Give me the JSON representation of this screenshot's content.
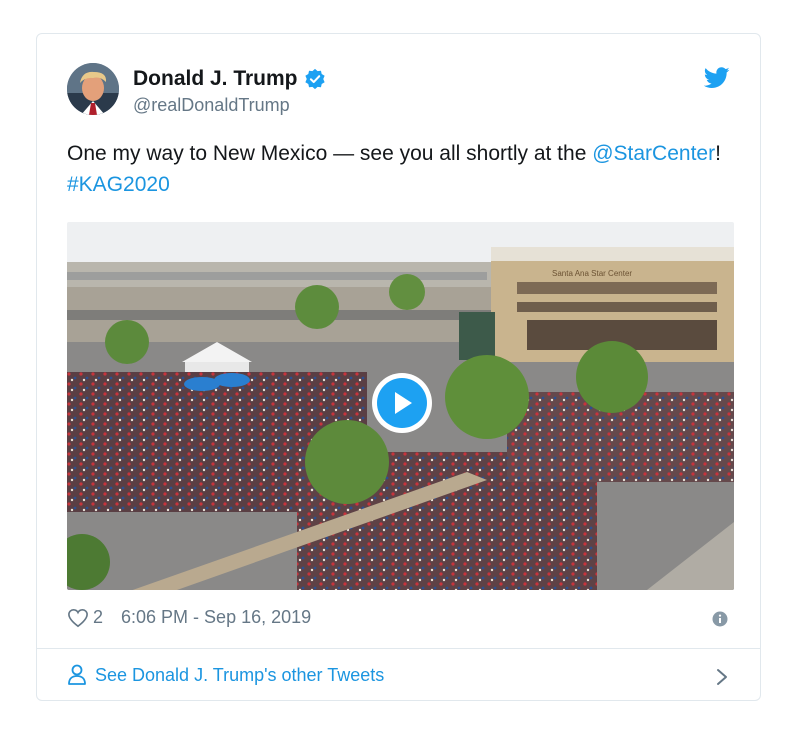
{
  "tweet": {
    "author_name": "Donald J. Trump",
    "author_handle": "@realDonaldTrump",
    "text_before": "One my way to New Mexico — see you all shortly at the ",
    "mention": "@StarCenter",
    "text_between": "! ",
    "hashtag": "#KAG2020",
    "likes": "2",
    "timestamp": "6:06 PM - Sep 16, 2019",
    "building_sign": "Santa Ana Star Center"
  },
  "footer": {
    "see_more_label": "See Donald J. Trump's other Tweets"
  },
  "icons": {
    "verified": "verified-badge-icon",
    "bird": "twitter-bird-icon",
    "play": "play-icon",
    "heart": "heart-icon",
    "info": "info-icon",
    "person": "person-icon",
    "chevron": "chevron-right-icon"
  },
  "colors": {
    "brand_blue": "#1da1f2",
    "link_blue": "#1b95e0",
    "text": "#14171a",
    "muted": "#657786",
    "border": "#e1e8ed"
  }
}
